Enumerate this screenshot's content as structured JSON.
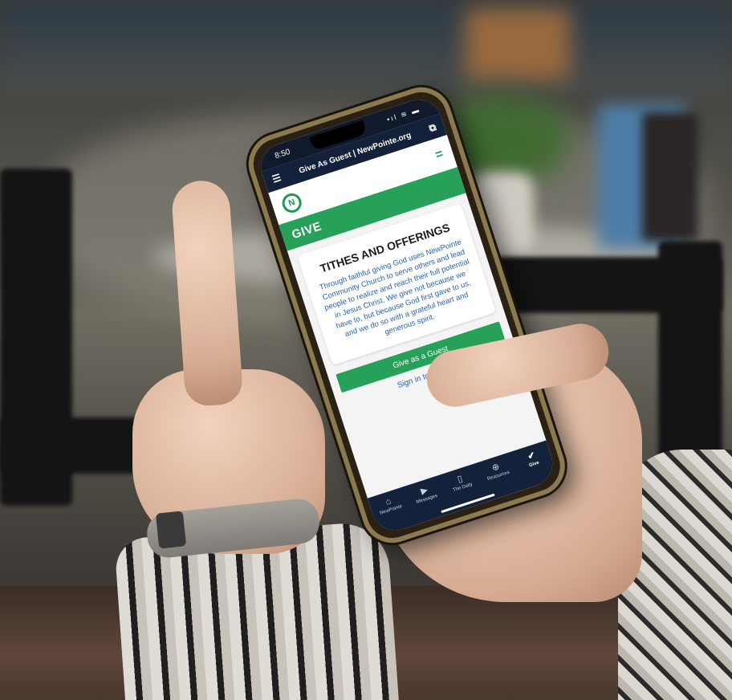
{
  "statusbar": {
    "time": "8:50",
    "icons": "•ıl ≋ ▬"
  },
  "appbar": {
    "title": "Give As Guest | NewPointe.org",
    "menu_icon": "☰",
    "cast_icon": "⧉"
  },
  "site": {
    "logo_letter": "N",
    "menu_icon": "="
  },
  "give_band": {
    "label": "GIVE"
  },
  "card": {
    "title": "TITHES AND OFFERINGS",
    "body": "Through faithful giving God uses NewPointe Community Church to serve others and lead people to realize and reach their full potential in Jesus Christ. We give not because we have to, but because God first gave to us, and we do so with a grateful heart and generous spirit."
  },
  "cta": {
    "label": "Give as a Guest"
  },
  "link": {
    "label": "Sign in to Give ❯"
  },
  "tabs": [
    {
      "label": "NewPointe",
      "glyph": "⌂"
    },
    {
      "label": "Messages",
      "glyph": "▶"
    },
    {
      "label": "The Daily",
      "glyph": "▯"
    },
    {
      "label": "Resources",
      "glyph": "⊕"
    },
    {
      "label": "Give",
      "glyph": "✔"
    }
  ],
  "colors": {
    "brand_green": "#27a15a",
    "navy": "#14213a",
    "link_blue": "#2a64a6"
  }
}
